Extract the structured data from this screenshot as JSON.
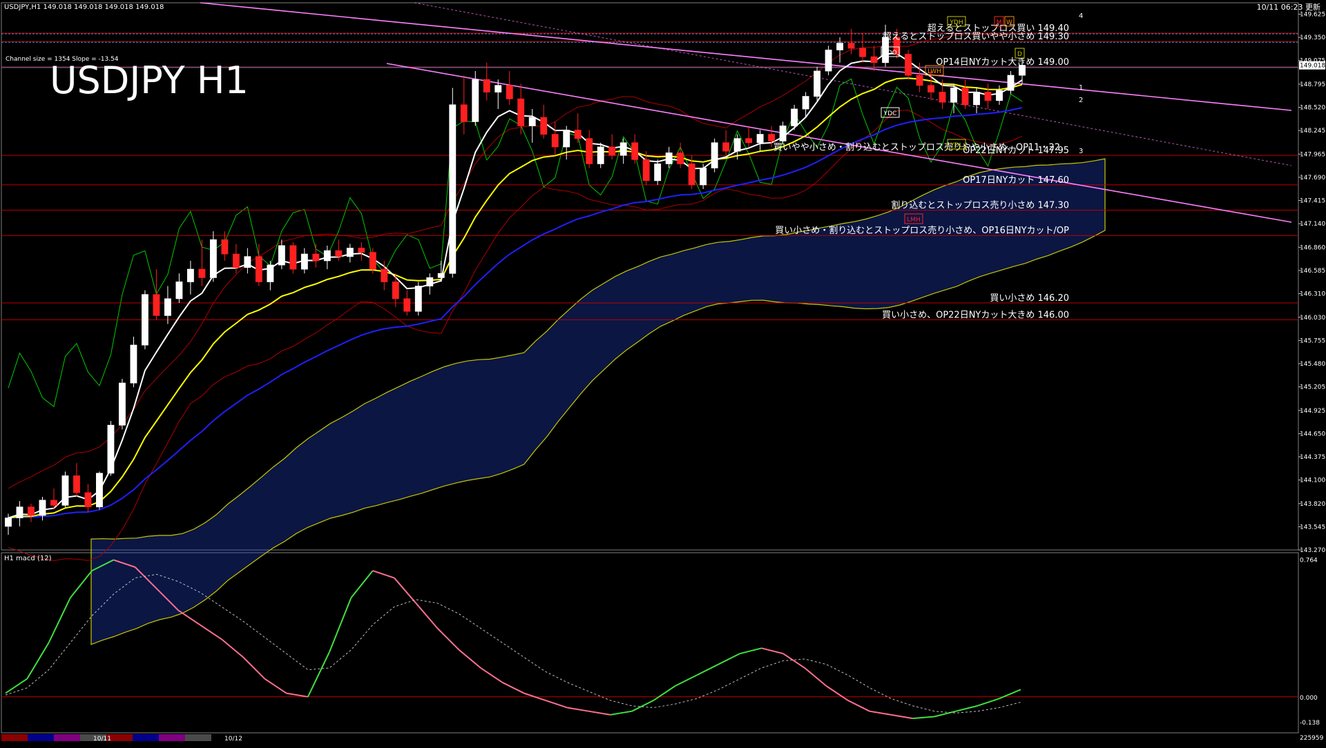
{
  "window": {
    "header": "USDJPY,H1  149.018 149.018 149.018 149.018",
    "timestamp": "10/11 06:23 更新",
    "title": "USDJPY H1",
    "channel_info": "Channel size = 1354 Slope = -13.54"
  },
  "colors": {
    "background": "#000000",
    "bull_candle": "#ffffff",
    "bear_candle": "#ff2020",
    "level_line": "#c00000",
    "level_text": "#ffffff",
    "channel": "#ff80ff",
    "ema_white": "#ffffff",
    "ema_yellow": "#ffff00",
    "ema_blue": "#2020ff",
    "rsi_green": "#00cc00",
    "kumo_blue": "#2040c0",
    "kumo_edge": "#c8c800",
    "macd_up": "#40e040",
    "macd_down": "#ff7090",
    "signal": "#c0c0c0",
    "pivot_line": "#3a8fd0"
  },
  "chart_data": [
    {
      "type": "candlestick",
      "title": "USDJPY H1",
      "symbol": "USDJPY",
      "timeframe": "H1",
      "ylim": [
        143.27,
        149.76
      ],
      "y_ticks": [
        149.625,
        149.35,
        149.075,
        148.795,
        148.52,
        148.245,
        147.965,
        147.69,
        147.415,
        147.14,
        146.86,
        146.585,
        146.31,
        146.03,
        145.755,
        145.48,
        145.205,
        144.925,
        144.65,
        144.375,
        144.1,
        143.82,
        143.545,
        143.27
      ],
      "current_price": 149.018,
      "x_labels": [
        "10/11",
        "10/12"
      ],
      "levels": [
        {
          "price": 149.4,
          "label": "超えるとストップロス買い 149.40"
        },
        {
          "price": 149.3,
          "label": "超えるとストップロス買いやや小さめ 149.30"
        },
        {
          "price": 149.0,
          "label": "OP14日NYカット大きめ 149.00"
        },
        {
          "price": 147.95,
          "label": "OP22日NYカット 147.95"
        },
        {
          "price": 147.6,
          "label": "OP17日NYカット 147.60"
        },
        {
          "price": 147.3,
          "label": "割り込むとストップロス売り小さめ 147.30"
        },
        {
          "price": 147.0,
          "label": "買い小さめ・割り込むとストップロス売り小さめ、OP16日NYカット/OP"
        },
        {
          "price": 146.2,
          "label": "買い小さめ 146.20"
        },
        {
          "price": 146.0,
          "label": "買い小さめ、OP22日NYカット大きめ 146.00"
        }
      ],
      "extra_label": {
        "price": 148.02,
        "label": "買いやや小さめ・割り込むとストップロス売りやや小さめ、OP11・22"
      },
      "pivot_labels": [
        "YDH",
        "YDO",
        "YDC",
        "YDL",
        "LWH",
        "LMH",
        "M",
        "W",
        "D"
      ],
      "projection_labels": [
        "4",
        "1",
        "2",
        "3"
      ],
      "candles": [
        [
          143.55,
          143.7,
          143.45,
          143.65
        ],
        [
          143.65,
          143.85,
          143.55,
          143.78
        ],
        [
          143.78,
          143.82,
          143.6,
          143.68
        ],
        [
          143.68,
          143.9,
          143.62,
          143.86
        ],
        [
          143.86,
          144.0,
          143.75,
          143.8
        ],
        [
          143.8,
          144.2,
          143.78,
          144.15
        ],
        [
          144.15,
          144.3,
          143.9,
          143.95
        ],
        [
          143.95,
          144.05,
          143.72,
          143.78
        ],
        [
          143.78,
          144.2,
          143.75,
          144.18
        ],
        [
          144.18,
          144.8,
          144.15,
          144.75
        ],
        [
          144.75,
          145.3,
          144.7,
          145.25
        ],
        [
          145.25,
          145.8,
          145.2,
          145.7
        ],
        [
          145.7,
          146.35,
          145.65,
          146.3
        ],
        [
          146.3,
          146.6,
          146.0,
          146.05
        ],
        [
          146.05,
          146.4,
          145.95,
          146.25
        ],
        [
          146.25,
          146.55,
          146.2,
          146.45
        ],
        [
          146.45,
          146.7,
          146.3,
          146.6
        ],
        [
          146.6,
          146.95,
          146.4,
          146.5
        ],
        [
          146.5,
          147.05,
          146.45,
          146.95
        ],
        [
          146.95,
          147.05,
          146.7,
          146.78
        ],
        [
          146.78,
          146.9,
          146.55,
          146.62
        ],
        [
          146.62,
          146.85,
          146.55,
          146.75
        ],
        [
          146.75,
          146.9,
          146.4,
          146.45
        ],
        [
          146.45,
          146.7,
          146.35,
          146.65
        ],
        [
          146.65,
          146.95,
          146.6,
          146.88
        ],
        [
          146.88,
          146.92,
          146.55,
          146.6
        ],
        [
          146.6,
          146.85,
          146.55,
          146.78
        ],
        [
          146.78,
          146.9,
          146.62,
          146.7
        ],
        [
          146.7,
          146.88,
          146.6,
          146.82
        ],
        [
          146.82,
          146.95,
          146.7,
          146.75
        ],
        [
          146.75,
          146.9,
          146.68,
          146.85
        ],
        [
          146.85,
          146.92,
          146.7,
          146.8
        ],
        [
          146.8,
          146.85,
          146.55,
          146.6
        ],
        [
          146.6,
          146.7,
          146.35,
          146.45
        ],
        [
          146.45,
          146.55,
          146.15,
          146.25
        ],
        [
          146.25,
          146.35,
          146.05,
          146.1
        ],
        [
          146.1,
          146.45,
          146.05,
          146.4
        ],
        [
          146.4,
          146.55,
          146.3,
          146.5
        ],
        [
          146.5,
          146.7,
          146.45,
          146.55
        ],
        [
          146.55,
          148.75,
          146.5,
          148.55
        ],
        [
          148.55,
          148.9,
          148.2,
          148.35
        ],
        [
          148.35,
          148.95,
          148.3,
          148.85
        ],
        [
          148.85,
          149.05,
          148.6,
          148.7
        ],
        [
          148.7,
          148.85,
          148.5,
          148.78
        ],
        [
          148.78,
          148.95,
          148.55,
          148.62
        ],
        [
          148.62,
          148.8,
          148.2,
          148.3
        ],
        [
          148.3,
          148.5,
          148.1,
          148.4
        ],
        [
          148.4,
          148.55,
          148.15,
          148.2
        ],
        [
          148.2,
          148.35,
          147.95,
          148.05
        ],
        [
          148.05,
          148.3,
          147.9,
          148.25
        ],
        [
          148.25,
          148.45,
          148.1,
          148.15
        ],
        [
          148.15,
          148.25,
          147.8,
          147.85
        ],
        [
          147.85,
          148.1,
          147.8,
          148.05
        ],
        [
          148.05,
          148.2,
          147.9,
          147.95
        ],
        [
          147.95,
          148.15,
          147.85,
          148.1
        ],
        [
          148.1,
          148.2,
          147.85,
          147.9
        ],
        [
          147.9,
          148.0,
          147.6,
          147.65
        ],
        [
          147.65,
          147.9,
          147.6,
          147.85
        ],
        [
          147.85,
          148.05,
          147.8,
          147.98
        ],
        [
          147.98,
          148.1,
          147.8,
          147.85
        ],
        [
          147.85,
          147.95,
          147.55,
          147.6
        ],
        [
          147.6,
          147.85,
          147.55,
          147.8
        ],
        [
          147.8,
          148.15,
          147.75,
          148.1
        ],
        [
          148.1,
          148.25,
          147.95,
          148.0
        ],
        [
          148.0,
          148.2,
          147.9,
          148.15
        ],
        [
          148.15,
          148.3,
          148.05,
          148.1
        ],
        [
          148.1,
          148.25,
          148.0,
          148.2
        ],
        [
          148.2,
          148.3,
          148.05,
          148.12
        ],
        [
          148.12,
          148.35,
          148.08,
          148.3
        ],
        [
          148.3,
          148.55,
          148.25,
          148.5
        ],
        [
          148.5,
          148.7,
          148.4,
          148.65
        ],
        [
          148.65,
          149.0,
          148.6,
          148.95
        ],
        [
          148.95,
          149.25,
          148.9,
          149.2
        ],
        [
          149.2,
          149.35,
          149.05,
          149.28
        ],
        [
          149.28,
          149.45,
          149.15,
          149.22
        ],
        [
          149.22,
          149.4,
          149.05,
          149.12
        ],
        [
          149.12,
          149.25,
          148.95,
          149.05
        ],
        [
          149.05,
          149.5,
          149.0,
          149.35
        ],
        [
          149.35,
          149.45,
          149.1,
          149.15
        ],
        [
          149.15,
          149.2,
          148.85,
          148.9
        ],
        [
          148.9,
          149.05,
          148.7,
          148.78
        ],
        [
          148.78,
          148.95,
          148.6,
          148.7
        ],
        [
          148.7,
          148.85,
          148.5,
          148.58
        ],
        [
          148.58,
          148.8,
          148.45,
          148.75
        ],
        [
          148.75,
          148.85,
          148.5,
          148.55
        ],
        [
          148.55,
          148.75,
          148.45,
          148.7
        ],
        [
          148.7,
          148.8,
          148.5,
          148.6
        ],
        [
          148.6,
          148.78,
          148.55,
          148.72
        ],
        [
          148.72,
          148.95,
          148.68,
          148.9
        ],
        [
          148.9,
          149.05,
          148.8,
          149.018
        ]
      ]
    },
    {
      "type": "line",
      "title": "H1 macd (12)",
      "ylim": [
        -0.2,
        0.8
      ],
      "y_ticks": [
        0.764,
        0.0,
        -0.138
      ],
      "bottom_value": "225959",
      "macd": [
        0.02,
        0.1,
        0.3,
        0.55,
        0.7,
        0.76,
        0.72,
        0.6,
        0.48,
        0.4,
        0.32,
        0.22,
        0.1,
        0.02,
        0.0,
        0.25,
        0.55,
        0.7,
        0.66,
        0.52,
        0.38,
        0.26,
        0.16,
        0.08,
        0.02,
        -0.02,
        -0.06,
        -0.08,
        -0.1,
        -0.08,
        -0.02,
        0.06,
        0.12,
        0.18,
        0.24,
        0.27,
        0.24,
        0.16,
        0.06,
        -0.02,
        -0.08,
        -0.1,
        -0.12,
        -0.11,
        -0.08,
        -0.05,
        -0.01,
        0.04
      ],
      "signal": [
        0.01,
        0.05,
        0.15,
        0.3,
        0.45,
        0.57,
        0.66,
        0.68,
        0.64,
        0.58,
        0.5,
        0.42,
        0.33,
        0.24,
        0.15,
        0.16,
        0.26,
        0.4,
        0.5,
        0.54,
        0.52,
        0.46,
        0.38,
        0.3,
        0.22,
        0.14,
        0.08,
        0.03,
        -0.02,
        -0.05,
        -0.06,
        -0.04,
        -0.01,
        0.04,
        0.1,
        0.16,
        0.2,
        0.21,
        0.18,
        0.12,
        0.05,
        -0.01,
        -0.05,
        -0.08,
        -0.09,
        -0.08,
        -0.06,
        -0.03
      ]
    }
  ]
}
